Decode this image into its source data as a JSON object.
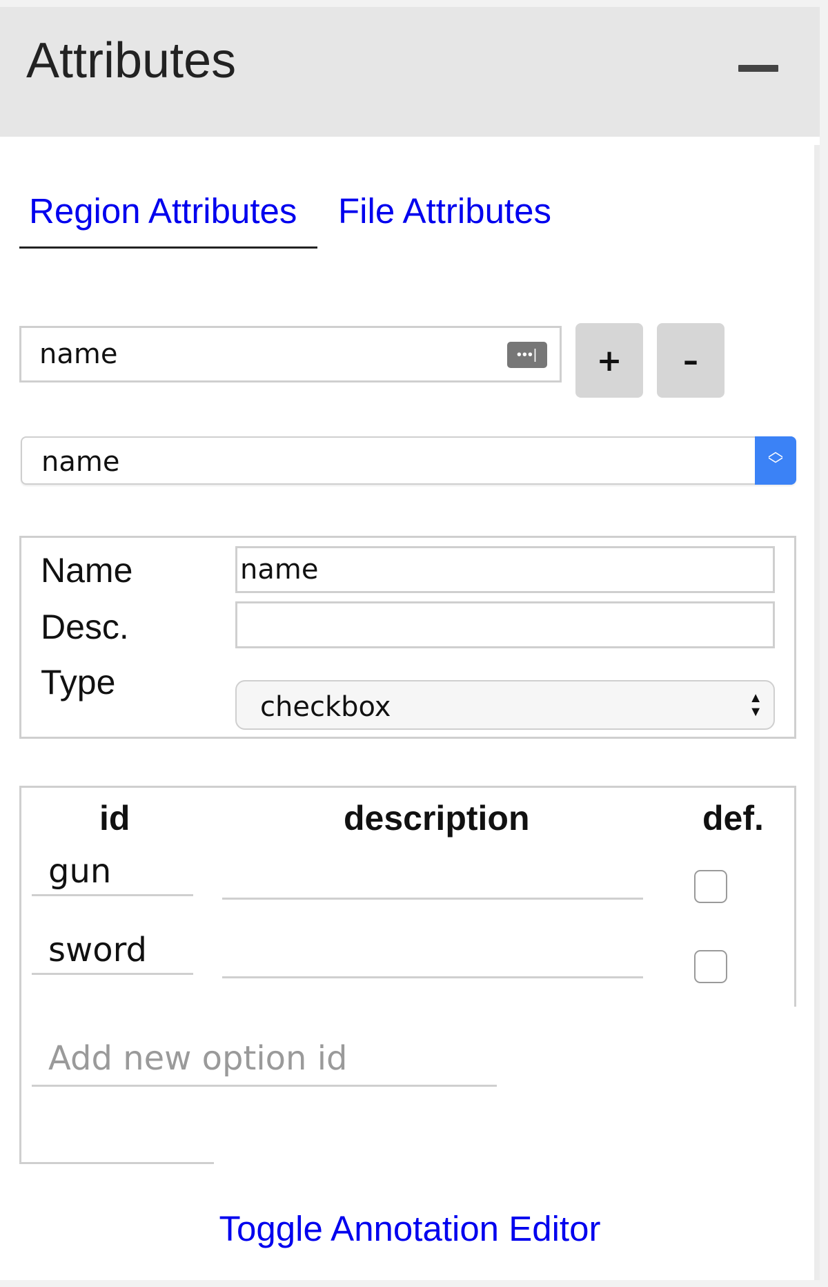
{
  "header": {
    "title": "Attributes",
    "collapse_icon": "minus-icon"
  },
  "tabs": [
    {
      "label": "Region Attributes",
      "active": true
    },
    {
      "label": "File Attributes",
      "active": false
    }
  ],
  "attribute_name_input": {
    "value": "name",
    "icon": "keychain-autofill-icon"
  },
  "buttons": {
    "add": "+",
    "remove": "–"
  },
  "attribute_select": {
    "selected": "name"
  },
  "properties": {
    "name_label": "Name",
    "name_value": "name",
    "desc_label": "Desc.",
    "desc_value": "",
    "type_label": "Type",
    "type_value": "checkbox"
  },
  "options_table": {
    "headers": {
      "id": "id",
      "description": "description",
      "default": "def."
    },
    "rows": [
      {
        "id": "gun",
        "description": "",
        "default": false
      },
      {
        "id": "sword",
        "description": "",
        "default": false
      }
    ],
    "new_option_placeholder": "Add new option id"
  },
  "footer": {
    "toggle_label": "Toggle Annotation Editor"
  },
  "colors": {
    "link": "#0000ee",
    "header_bg": "#e6e6e6",
    "select_accent": "#3b82f6"
  }
}
